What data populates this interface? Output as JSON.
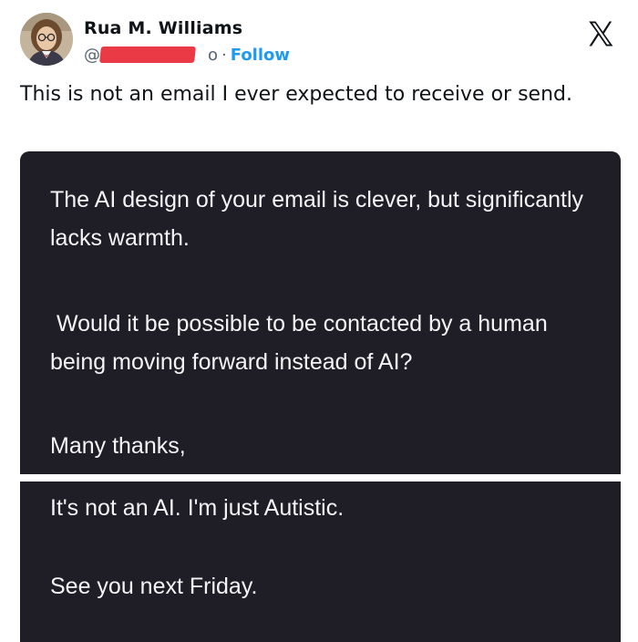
{
  "author": {
    "name": "Rua M. Williams",
    "handle_prefix": "@",
    "handle_visible_suffix": "o",
    "separator": "·",
    "follow_label": "Follow"
  },
  "platform": {
    "logo_icon": "x-logo-icon"
  },
  "tweet": {
    "text": "This is not an email I ever expected to receive or send."
  },
  "embedded_image": {
    "message_1": "The AI design of your email is clever, but significantly lacks warmth.",
    "message_2": " Would it be possible to be contacted by a human being moving forward instead of AI?",
    "message_3": "Many thanks,",
    "reply_1": "It's not an AI. I'm just Autistic.",
    "reply_2": "See you next Friday."
  },
  "colors": {
    "panel_background": "#1f1e27",
    "panel_text": "#f4f4f6",
    "follow": "#1d9bf0",
    "redaction": "#ea3a45"
  }
}
